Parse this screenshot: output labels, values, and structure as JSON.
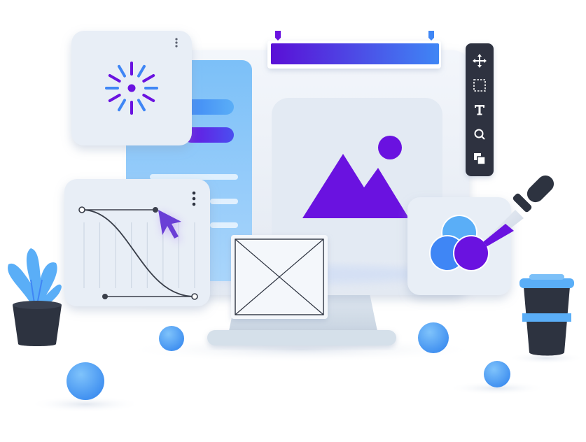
{
  "palette": {
    "violet": "#6a12e0",
    "blue": "#3f86f5",
    "sky": "#5aaef7",
    "panel": "#e8eef6",
    "dark": "#2d3340",
    "ink": "#3a3f4a",
    "white": "#ffffff"
  },
  "toolbar": {
    "tools": [
      "move-icon",
      "marquee-select-icon",
      "text-tool-icon",
      "zoom-icon",
      "layers-icon"
    ]
  },
  "gradient_bar": {
    "colors": [
      "#5a0fd6",
      "#3f86f5"
    ]
  },
  "spinner": {
    "ray_count": 12
  },
  "curve_editor": {
    "grid_lines": 8
  },
  "color_mix": {
    "circles": [
      "#5aaef7",
      "#3f86f5",
      "#6a12e0"
    ]
  }
}
